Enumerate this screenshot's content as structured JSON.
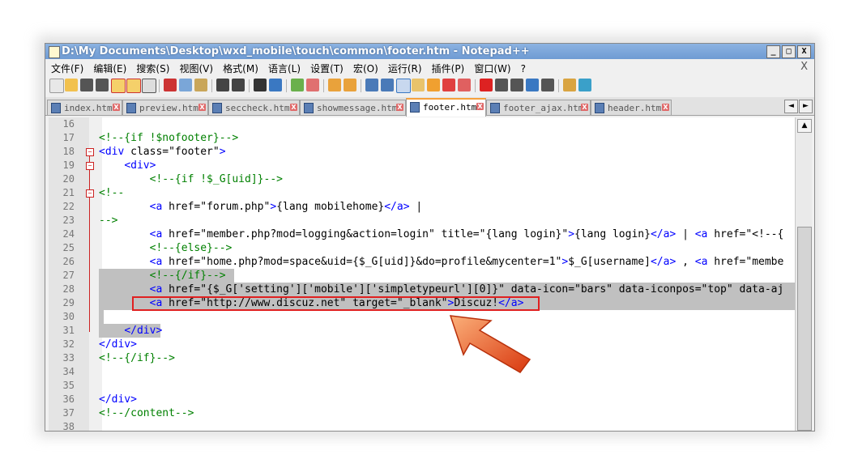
{
  "window": {
    "title": "D:\\My Documents\\Desktop\\wxd_mobile\\touch\\common\\footer.htm - Notepad++",
    "controls": [
      "_",
      "□",
      "X"
    ]
  },
  "menu": [
    "文件(F)",
    "编辑(E)",
    "搜索(S)",
    "视图(V)",
    "格式(M)",
    "语言(L)",
    "设置(T)",
    "宏(O)",
    "运行(R)",
    "插件(P)",
    "窗口(W)",
    "?"
  ],
  "menu_close": "X",
  "tabs": [
    {
      "label": "index.htm",
      "active": false
    },
    {
      "label": "preview.htm",
      "active": false
    },
    {
      "label": "seccheck.htm",
      "active": false
    },
    {
      "label": "showmessage.htm",
      "active": false
    },
    {
      "label": "footer.htm",
      "active": true
    },
    {
      "label": "footer_ajax.htm",
      "active": false
    },
    {
      "label": "header.htm",
      "active": false
    }
  ],
  "tab_close_glyph": "X",
  "tab_nav": [
    "◄",
    "►"
  ],
  "editor": {
    "lines": [
      {
        "n": "16",
        "code": ""
      },
      {
        "n": "17",
        "code": "<!--{if !$nofooter}-->"
      },
      {
        "n": "18",
        "code": "<div class=\"footer\">"
      },
      {
        "n": "19",
        "code": "    <div>"
      },
      {
        "n": "20",
        "code": "        <!--{if !$_G[uid]}-->"
      },
      {
        "n": "21",
        "code": "<!--"
      },
      {
        "n": "22",
        "code": "        <a href=\"forum.php\">{lang mobilehome}</a> |"
      },
      {
        "n": "23",
        "code": "-->"
      },
      {
        "n": "24",
        "code": "        <a href=\"member.php?mod=logging&action=login\" title=\"{lang login}\">{lang login}</a> | <a href=\"<!--{"
      },
      {
        "n": "25",
        "code": "        <!--{else}-->"
      },
      {
        "n": "26",
        "code": "        <a href=\"home.php?mod=space&uid={$_G[uid]}&do=profile&mycenter=1\">$_G[username]</a> , <a href=\"membe"
      },
      {
        "n": "27",
        "code": "        <!--{/if}-->"
      },
      {
        "n": "28",
        "code": "        <a href=\"{$_G['setting']['mobile']['simpletypeurl'][0]}\" data-icon=\"bars\" data-iconpos=\"top\" data-aj"
      },
      {
        "n": "29",
        "code": "        <a href=\"http://www.discuz.net\" target=\"_blank\">Discuz!</a>"
      },
      {
        "n": "30",
        "code": ""
      },
      {
        "n": "31",
        "code": "    </div>"
      },
      {
        "n": "32",
        "code": "</div>"
      },
      {
        "n": "33",
        "code": "<!--{/if}-->"
      },
      {
        "n": "34",
        "code": ""
      },
      {
        "n": "35",
        "code": ""
      },
      {
        "n": "36",
        "code": "</div>"
      },
      {
        "n": "37",
        "code": "<!--/content-->"
      },
      {
        "n": "38",
        "code": ""
      }
    ]
  },
  "scroll_up": "▲",
  "colors": {
    "tag": "#0000ff",
    "attr": "#ff0000",
    "value": "#8000ff",
    "comment": "#008000",
    "highlight_box": "#e02020",
    "arrow": "#f15a22"
  }
}
